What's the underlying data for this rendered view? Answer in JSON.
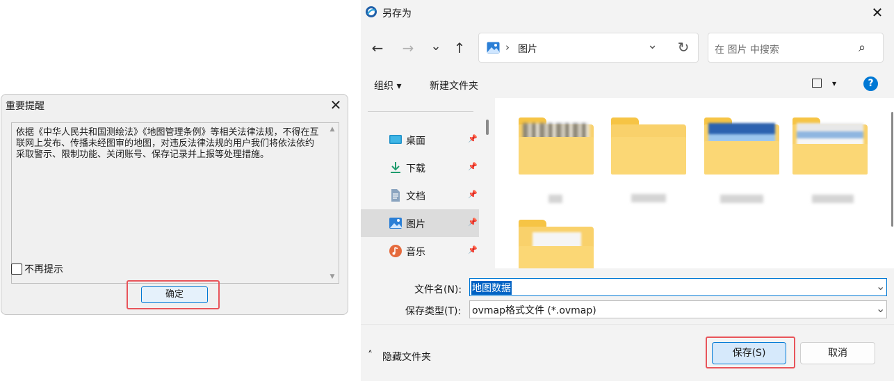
{
  "notice": {
    "title": "重要提醒",
    "close": "✕",
    "message": "依据《中华人民共和国测绘法》《地图管理条例》等相关法律法规，不得在互联网上发布、传播未经图审的地图，对违反法律法规的用户我们将依法依约采取警示、限制功能、关闭账号、保存记录并上报等处理措施。",
    "checkbox_label": "不再提示",
    "checkbox_checked": false,
    "ok_label": "确定",
    "scroll_up": "▲",
    "scroll_down": "▼"
  },
  "saveas": {
    "title": "另存为",
    "close": "✕",
    "nav": {
      "back": "←",
      "forward": "→",
      "recent": "⌄",
      "up": "↑"
    },
    "address": {
      "current": "图片",
      "separator": "›",
      "dropdown": "⌄",
      "refresh": "↻"
    },
    "search": {
      "placeholder": "在 图片 中搜索",
      "icon": "⌕"
    },
    "toolbar": {
      "organize": "组织 ▾",
      "new_folder": "新建文件夹",
      "view_dropdown": "▾",
      "help": "?"
    },
    "sidebar": {
      "items": [
        {
          "label": "桌面",
          "icon": "desktop-icon"
        },
        {
          "label": "下载",
          "icon": "download-icon"
        },
        {
          "label": "文档",
          "icon": "document-icon"
        },
        {
          "label": "图片",
          "icon": "pictures-icon",
          "selected": true
        },
        {
          "label": "音乐",
          "icon": "music-icon"
        }
      ],
      "pin": "📌"
    },
    "filename_label": "文件名(N):",
    "filename_value": "地图数据",
    "filetype_label": "保存类型(T):",
    "filetype_value": "ovmap格式文件 (*.ovmap)",
    "hide_folders": "隐藏文件夹",
    "hide_chevron": "˄",
    "save_label": "保存(S)",
    "cancel_label": "取消",
    "colors": {
      "accent": "#0078d4",
      "highlight": "#e8545a",
      "folder": "#f9d16b"
    }
  }
}
